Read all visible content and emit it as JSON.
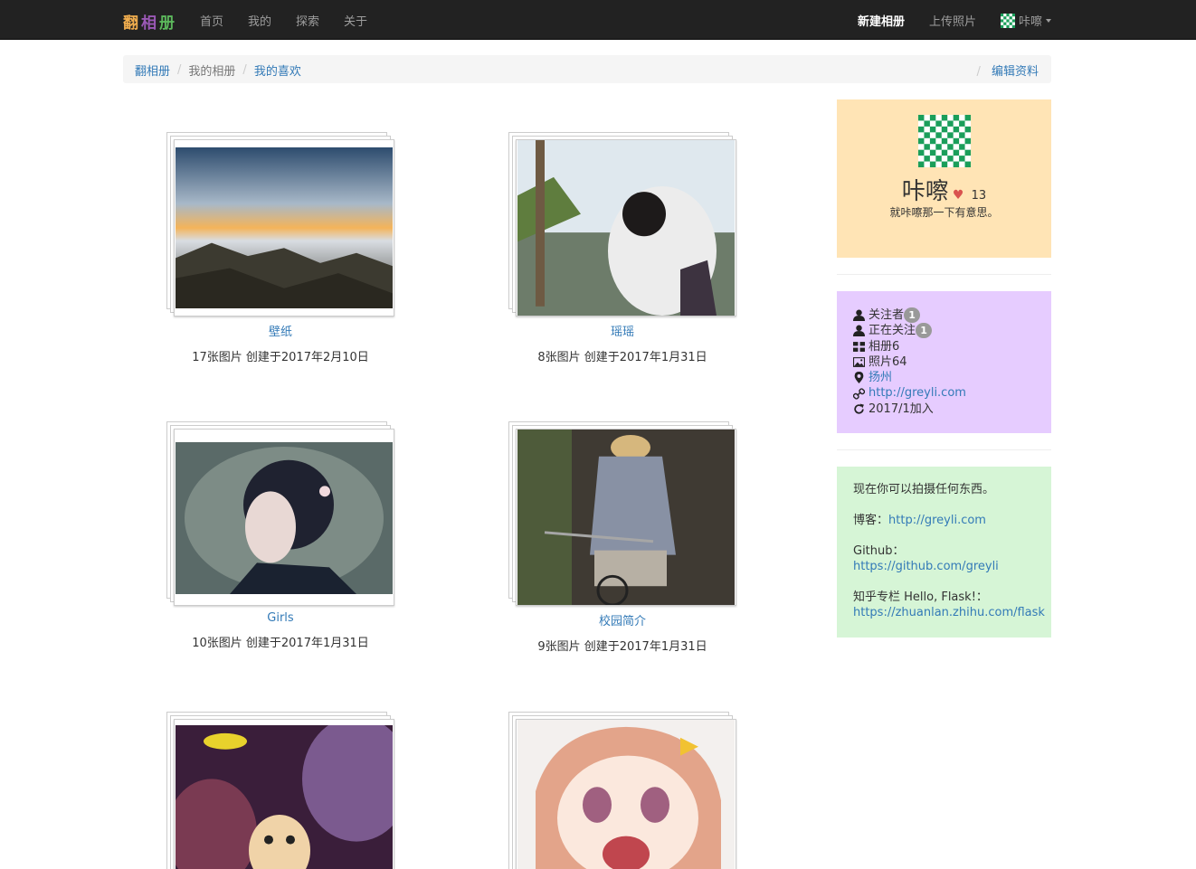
{
  "navbar": {
    "brand": [
      "翻",
      "相",
      "册"
    ],
    "links": [
      "首页",
      "我的",
      "探索",
      "关于"
    ],
    "new_album": "新建相册",
    "upload": "上传照片",
    "username": "咔嚓"
  },
  "breadcrumb": {
    "home": "翻相册",
    "my_albums": "我的相册",
    "my_likes": "我的喜欢",
    "sep": "/",
    "edit_profile": "编辑资料"
  },
  "albums": [
    {
      "title": "壁纸",
      "meta": "17张图片 创建于2017年2月10日"
    },
    {
      "title": "瑶瑶",
      "meta": "8张图片 创建于2017年1月31日"
    },
    {
      "title": "Girls",
      "meta": "10张图片 创建于2017年1月31日"
    },
    {
      "title": "校园简介",
      "meta": "9张图片 创建于2017年1月31日"
    },
    {
      "title": "",
      "meta": ""
    },
    {
      "title": "",
      "meta": ""
    }
  ],
  "profile": {
    "name": "咔嚓",
    "likes": "13",
    "bio": "就咔嚓那一下有意思。"
  },
  "stats": {
    "followers_label": "关注者",
    "followers_count": "1",
    "following_label": "正在关注",
    "following_count": "1",
    "albums": "相册6",
    "photos": "照片64",
    "location": "扬州",
    "website": "http://greyli.com",
    "joined": "2017/1加入"
  },
  "about": {
    "line1": "现在你可以拍摄任何东西。",
    "blog_label": "博客：",
    "blog_url": "http://greyli.com",
    "github_label": "Github：",
    "github_url": "https://github.com/greyli",
    "zhihu_label": "知乎专栏 Hello, Flask!：",
    "zhihu_url": "https://zhuanlan.zhihu.com/flask"
  },
  "colors": {
    "navbar_bg": "#222222",
    "link": "#337ab7",
    "profile_bg": "#ffe4b5",
    "stats_bg": "#e6ccff",
    "about_bg": "#d6f5d6"
  }
}
